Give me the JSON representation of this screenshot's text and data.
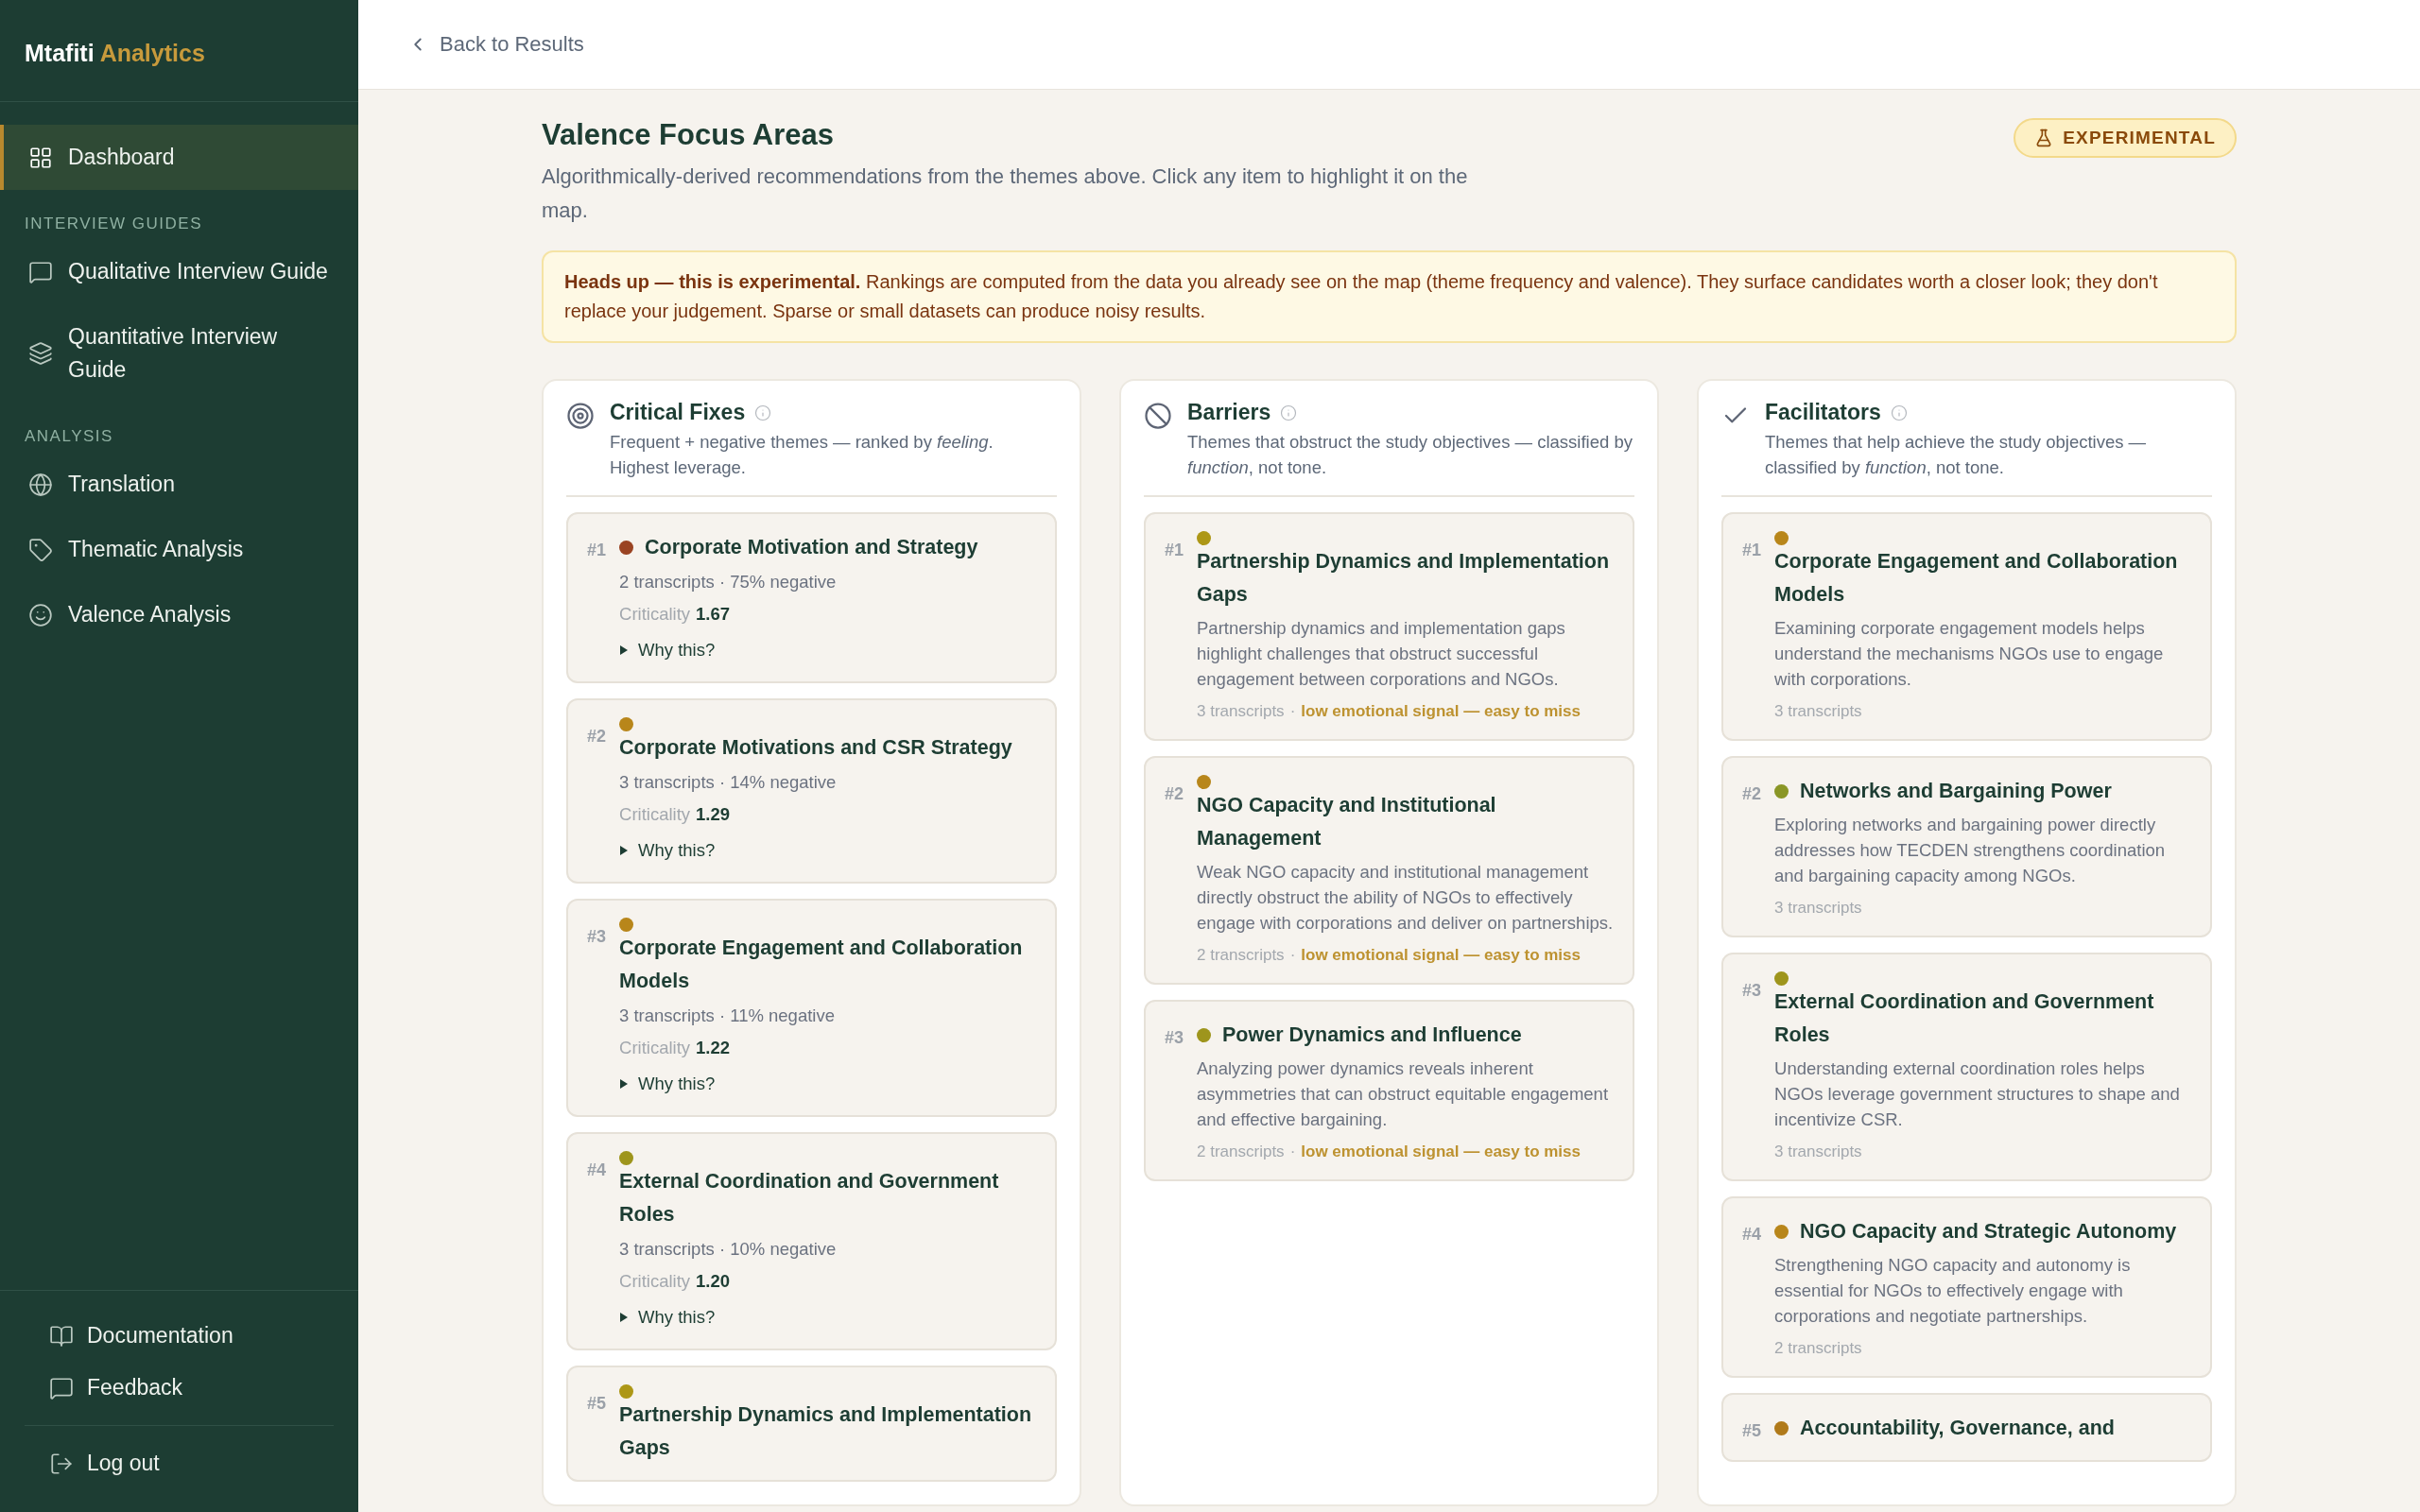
{
  "sidebar": {
    "brand": {
      "name": "Mtafiti",
      "accent": "Analytics"
    },
    "items": [
      {
        "kind": "link",
        "label": "Dashboard",
        "selected": true
      },
      {
        "kind": "section",
        "label": "INTERVIEW GUIDES"
      },
      {
        "kind": "link",
        "label": "Qualitative Interview Guide",
        "selected": false
      },
      {
        "kind": "link",
        "label": "Quantitative Interview Guide",
        "selected": false
      },
      {
        "kind": "section",
        "label": "ANALYSIS"
      },
      {
        "kind": "link",
        "label": "Translation",
        "selected": false
      },
      {
        "kind": "link",
        "label": "Thematic Analysis",
        "selected": false
      },
      {
        "kind": "link",
        "label": "Valence Analysis",
        "selected": false
      }
    ],
    "footer": [
      {
        "label": "Documentation"
      },
      {
        "label": "Feedback"
      }
    ],
    "logout": {
      "label": "Log out"
    }
  },
  "header": {
    "back": "Back to Results"
  },
  "page": {
    "title": "Valence Focus Areas",
    "subtitle": "Algorithmically-derived recommendations from the themes above. Click any item to highlight it on the map.",
    "badge": "EXPERIMENTAL",
    "notice": "**Heads up — this is experimental.** Rankings are computed from the data you already see on the map (theme frequency and valence). They surface candidates worth a closer look; they don't replace your judgement. Sparse or small datasets can produce noisy results."
  },
  "columns": [
    {
      "kind": "critical",
      "title": "Critical Fixes",
      "description": "Frequent + negative themes — ranked by *feeling*. Highest leverage.",
      "items": [
        {
          "kind": "ranked",
          "rank": "#1",
          "color": "#9a4322",
          "title": "Corporate Motivation and Strategy",
          "meta": "2 transcripts · 75% negative",
          "criticality_label": "Criticality",
          "criticality": "1.67",
          "why": "Why this?",
          "expanded": false
        },
        {
          "kind": "ranked",
          "rank": "#2",
          "color": "#b8861a",
          "title": "Corporate Motivations and CSR Strategy",
          "meta": "3 transcripts · 14% negative",
          "criticality_label": "Criticality",
          "criticality": "1.29",
          "why": "Why this?",
          "expanded": false
        },
        {
          "kind": "ranked",
          "rank": "#3",
          "color": "#b8861a",
          "title": "Corporate Engagement and Collaboration Models",
          "meta": "3 transcripts · 11% negative",
          "criticality_label": "Criticality",
          "criticality": "1.22",
          "why": "Why this?",
          "expanded": false
        },
        {
          "kind": "ranked",
          "rank": "#4",
          "color": "#9e951c",
          "title": "External Coordination and Government Roles",
          "meta": "3 transcripts · 10% negative",
          "criticality_label": "Criticality",
          "criticality": "1.20",
          "why": "Why this?",
          "expanded": false
        },
        {
          "kind": "ranked",
          "rank": "#5",
          "color": "#ad9716",
          "title": "Partnership Dynamics and Implementation Gaps"
        }
      ]
    },
    {
      "kind": "barrier",
      "title": "Barriers",
      "description": "Themes that obstruct the study objectives — classified by *function*, not tone.",
      "items": [
        {
          "kind": "described",
          "rank": "#1",
          "color": "#ad9716",
          "title": "Partnership Dynamics and Implementation Gaps",
          "description": "Partnership dynamics and implementation gaps highlight challenges that obstruct successful engagement between corporations and NGOs.",
          "transcripts": "3 transcripts",
          "separator": "·",
          "signal": "low emotional signal — easy to miss"
        },
        {
          "kind": "described",
          "rank": "#2",
          "color": "#b8861a",
          "title": "NGO Capacity and Institutional Management",
          "description": "Weak NGO capacity and institutional management directly obstruct the ability of NGOs to effectively engage with corporations and deliver on partnerships.",
          "transcripts": "2 transcripts",
          "separator": "·",
          "signal": "low emotional signal — easy to miss"
        },
        {
          "kind": "described",
          "rank": "#3",
          "color": "#9e951c",
          "title": "Power Dynamics and Influence",
          "description": "Analyzing power dynamics reveals inherent asymmetries that can obstruct equitable engagement and effective bargaining.",
          "transcripts": "2 transcripts",
          "separator": "·",
          "signal": "low emotional signal — easy to miss"
        }
      ]
    },
    {
      "kind": "facilitator",
      "title": "Facilitators",
      "description": "Themes that help achieve the study objectives — classified by *function*, not tone.",
      "items": [
        {
          "kind": "described",
          "rank": "#1",
          "color": "#b8861a",
          "title": "Corporate Engagement and Collaboration Models",
          "description": "Examining corporate engagement models helps understand the mechanisms NGOs use to engage with corporations.",
          "transcripts": "3 transcripts"
        },
        {
          "kind": "described",
          "rank": "#2",
          "color": "#8a9626",
          "title": "Networks and Bargaining Power",
          "description": "Exploring networks and bargaining power directly addresses how TECDEN strengthens coordination and bargaining capacity among NGOs.",
          "transcripts": "3 transcripts"
        },
        {
          "kind": "described",
          "rank": "#3",
          "color": "#9e951c",
          "title": "External Coordination and Government Roles",
          "description": "Understanding external coordination roles helps NGOs leverage government structures to shape and incentivize CSR.",
          "transcripts": "3 transcripts"
        },
        {
          "kind": "described",
          "rank": "#4",
          "color": "#b8861a",
          "title": "NGO Capacity and Strategic Autonomy",
          "description": "Strengthening NGO capacity and autonomy is essential for NGOs to effectively engage with corporations and negotiate partnerships.",
          "transcripts": "2 transcripts"
        },
        {
          "kind": "described",
          "rank": "#5",
          "color": "#b07a1a",
          "title": "Accountability, Governance, and"
        }
      ]
    }
  ]
}
